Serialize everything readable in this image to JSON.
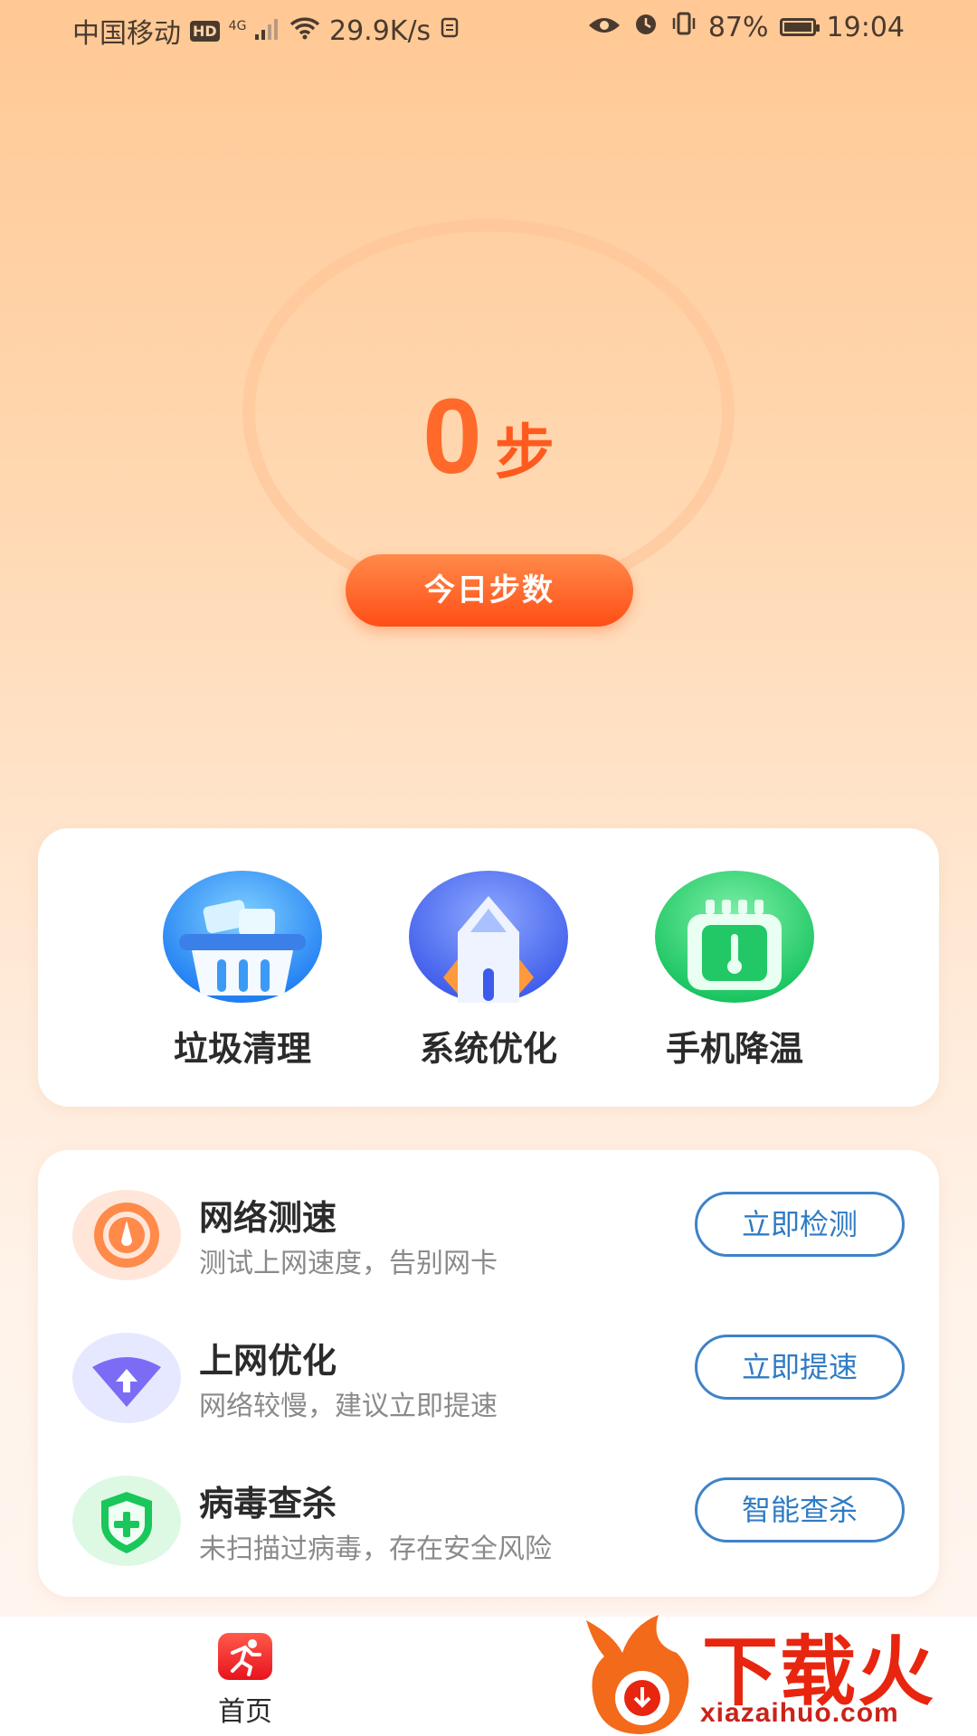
{
  "status_bar": {
    "carrier": "中国移动",
    "hd": "HD",
    "network": "4G",
    "speed": "29.9K/s",
    "battery": "87%",
    "time": "19:04"
  },
  "steps": {
    "count": "0",
    "unit": "步",
    "button_label": "今日步数"
  },
  "tools": [
    {
      "label": "垃圾清理",
      "icon": "trash-basket-icon"
    },
    {
      "label": "系统优化",
      "icon": "rocket-house-icon"
    },
    {
      "label": "手机降温",
      "icon": "thermometer-chip-icon"
    }
  ],
  "features": [
    {
      "title": "网络测速",
      "subtitle": "测试上网速度，告别网卡",
      "button": "立即检测",
      "icon": "speedometer-icon"
    },
    {
      "title": "上网优化",
      "subtitle": "网络较慢，建议立即提速",
      "button": "立即提速",
      "icon": "wifi-up-icon"
    },
    {
      "title": "病毒查杀",
      "subtitle": "未扫描过病毒，存在安全风险",
      "button": "智能查杀",
      "icon": "shield-plus-icon"
    }
  ],
  "bottom_nav": {
    "home_label": "首页"
  },
  "watermark": {
    "brand": "下载火",
    "url": "xiazaihuo.com"
  },
  "colors": {
    "accent": "#FF5A1E",
    "button_border": "#3D83C9"
  }
}
